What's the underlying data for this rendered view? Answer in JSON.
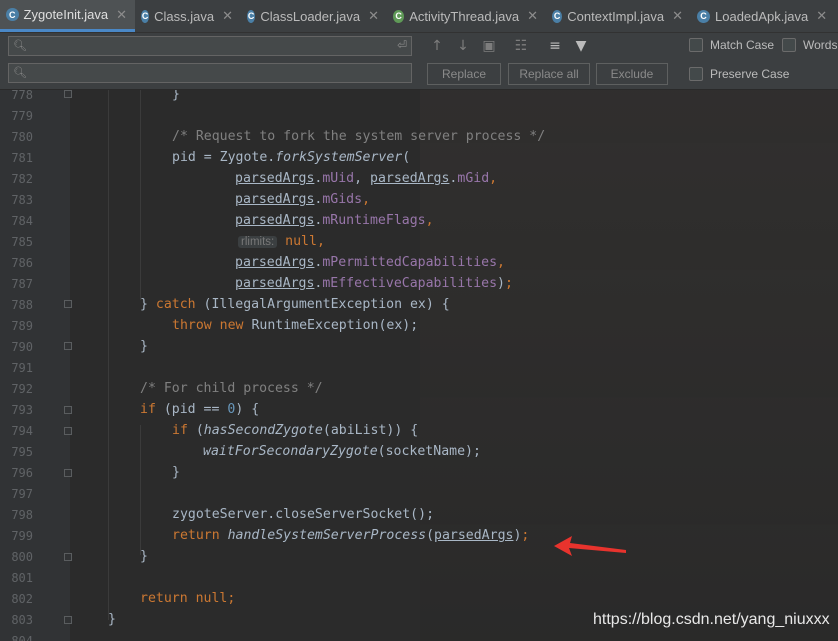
{
  "tabs": [
    {
      "label": "ZygoteInit.java",
      "active": true
    },
    {
      "label": "Class.java",
      "active": false
    },
    {
      "label": "ClassLoader.java",
      "active": false
    },
    {
      "label": "ActivityThread.java",
      "active": false
    },
    {
      "label": "ContextImpl.java",
      "active": false
    },
    {
      "label": "LoadedApk.java",
      "active": false
    }
  ],
  "search": {
    "find_value": "",
    "replace_value": "",
    "find_icon": "magnifier-icon",
    "history_icon": "history-icon",
    "buttons": {
      "replace": "Replace",
      "replace_all": "Replace all",
      "exclude": "Exclude"
    },
    "options": {
      "match_case": "Match Case",
      "words": "Words",
      "preserve_case": "Preserve Case"
    }
  },
  "lines": [
    "778",
    "779",
    "780",
    "781",
    "782",
    "783",
    "784",
    "785",
    "786",
    "787",
    "788",
    "789",
    "790",
    "791",
    "792",
    "793",
    "794",
    "795",
    "796",
    "797",
    "798",
    "799",
    "800",
    "801",
    "802",
    "803",
    "804"
  ],
  "code": {
    "l778": "}",
    "l780": "/* Request to fork the system server process */",
    "l781_a": "pid = Zygote.",
    "l781_m": "forkSystemServer",
    "l781_b": "(",
    "args": [
      "parsedArgs",
      ".",
      "mUid",
      ", ",
      "parsedArgs",
      ".",
      "mGid",
      ","
    ],
    "l783_a": "parsedArgs",
    "l783_f": "mGids",
    "l784_a": "parsedArgs",
    "l784_f": "mRuntimeFlags",
    "l785_hint": "rlimits:",
    "l785_v": "null",
    "l786_a": "parsedArgs",
    "l786_f": "mPermittedCapabilities",
    "l787_a": "parsedArgs",
    "l787_f": "mEffectiveCapabilities",
    "l788_kw": "catch",
    "l788_b": "(IllegalArgumentException ex) {",
    "l789_kw1": "throw",
    "l789_kw2": "new",
    "l789_b": "RuntimeException(ex);",
    "l790": "}",
    "l792": "/* For child process */",
    "l793_kw": "if",
    "l793_a": "(pid == ",
    "l793_n": "0",
    "l793_b": ") {",
    "l794_kw": "if",
    "l794_m": "hasSecondZygote",
    "l794_b": "(abiList)) {",
    "l795_m": "waitForSecondaryZygote",
    "l795_b": "(socketName);",
    "l796": "}",
    "l798": "zygoteServer.closeServerSocket();",
    "l799_kw": "return",
    "l799_m": "handleSystemServerProcess",
    "l799_a": "parsedArgs",
    "l800": "}",
    "l802_kw": "return",
    "l802_v": "null",
    "l803": "}"
  },
  "watermark": "https://blog.csdn.net/yang_niuxxx",
  "colors": {
    "accent": "#4a88c7",
    "arrow": "#e8332d"
  }
}
